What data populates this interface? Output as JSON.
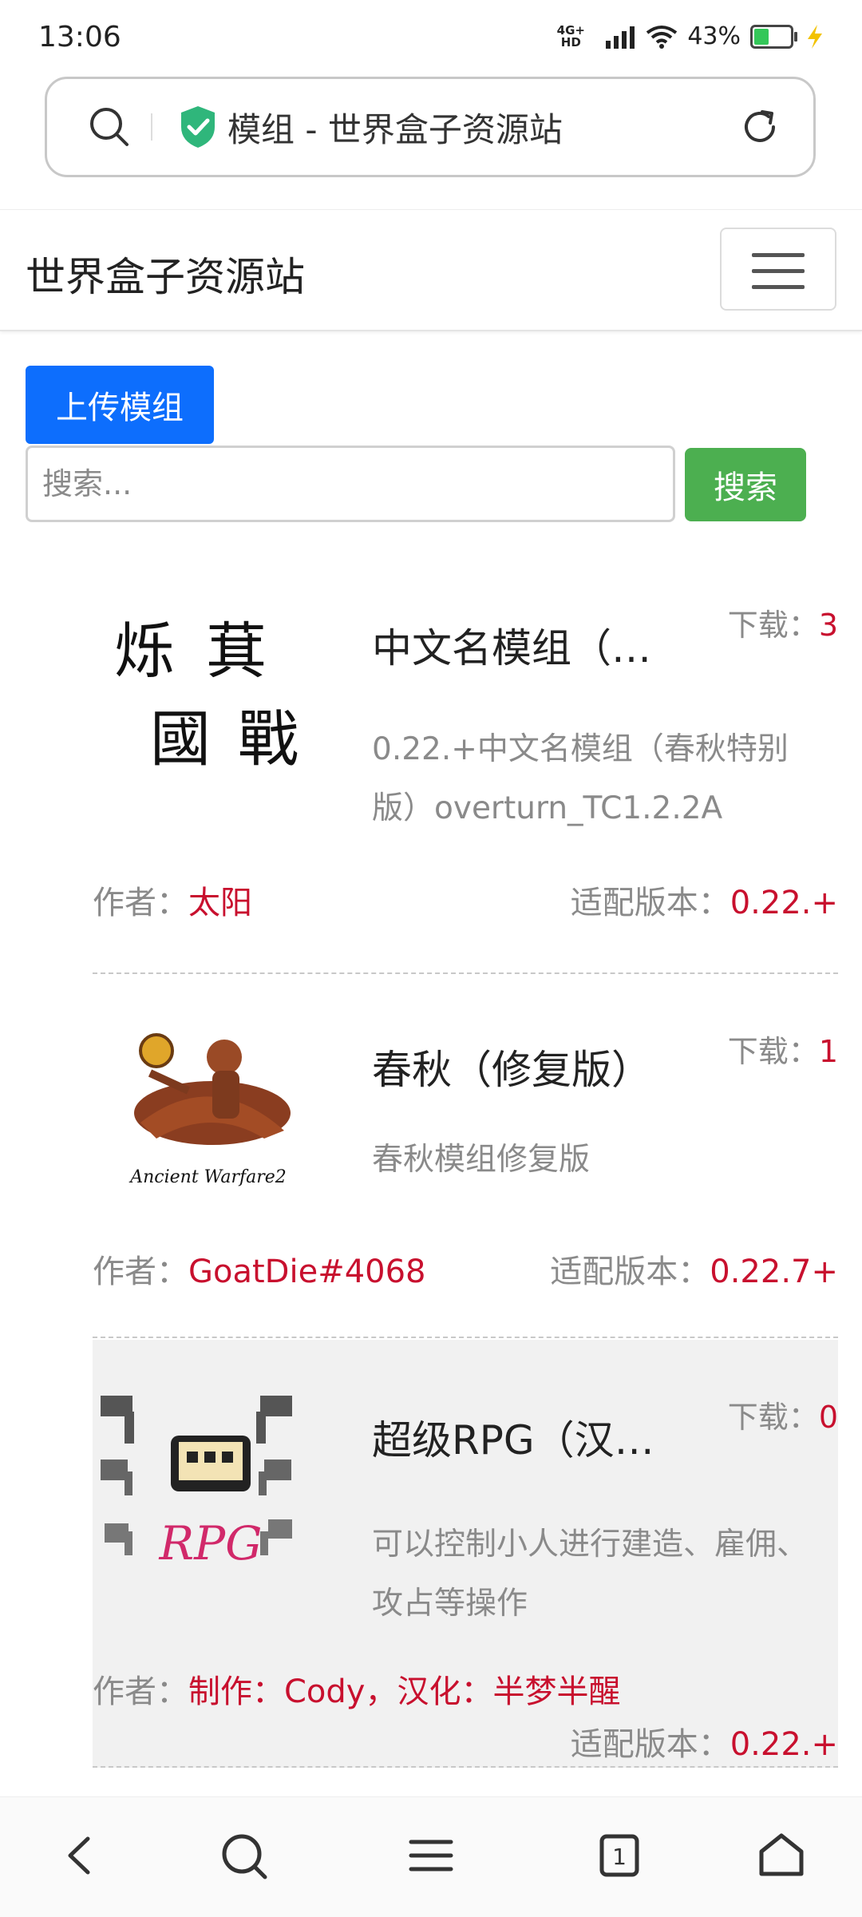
{
  "status_bar": {
    "time": "13:06",
    "network_top": "4G+ HD",
    "battery": "43%"
  },
  "browser": {
    "page_title": "模组 - 世界盒子资源站"
  },
  "site": {
    "brand": "世界盒子资源站"
  },
  "actions": {
    "upload_label": "上传模组",
    "search_placeholder": "搜索...",
    "search_label": "搜索"
  },
  "labels": {
    "downloads": "下载：",
    "author": "作者：",
    "version": "适配版本："
  },
  "mods": [
    {
      "title": "中文名模组（…",
      "downloads": "3",
      "description": "0.22.+中文名模组（春秋特别版）overturn_TC1.2.2A",
      "author": "太阳",
      "version": "0.22.+",
      "thumb_chars": [
        "烁",
        "萁",
        "國",
        "戰"
      ]
    },
    {
      "title": "春秋（修复版）",
      "downloads": "1",
      "description": "春秋模组修复版",
      "author": "GoatDie#4068",
      "version": "0.22.7+",
      "thumb_caption": "Ancient Warfare2"
    },
    {
      "title": "超级RPG（汉…",
      "downloads": "0",
      "description": "可以控制小人进行建造、雇佣、攻占等操作",
      "author": "制作：Cody，汉化：半梦半醒",
      "version": "0.22.+",
      "thumb_caption": "RPG"
    }
  ],
  "colors": {
    "primary": "#0d6efd",
    "success": "#4caf50",
    "accent_red": "#c8102e",
    "muted": "#8a8a8a"
  },
  "icons": [
    "search-icon",
    "shield-check-icon",
    "reload-icon",
    "menu-icon",
    "back-icon",
    "tabs-icon",
    "home-icon"
  ]
}
